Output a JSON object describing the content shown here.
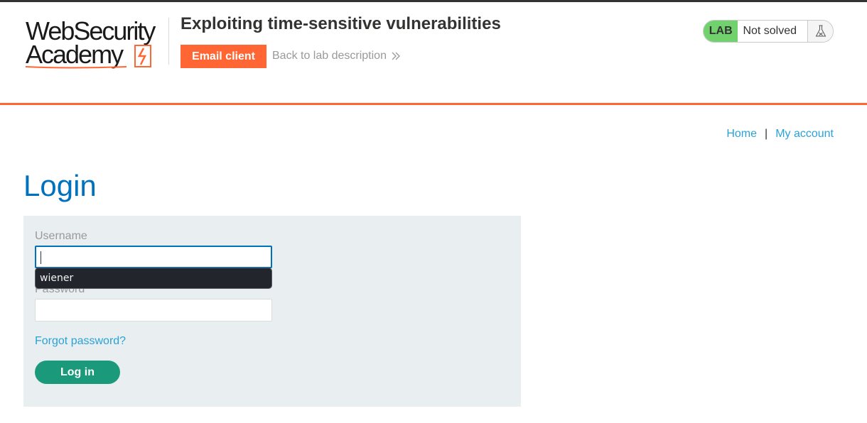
{
  "header": {
    "logo": {
      "line1": "WebSecurity",
      "line2": "Academy"
    },
    "lab_title": "Exploiting time-sensitive vulnerabilities",
    "email_client_label": "Email client",
    "back_link_label": "Back to lab description",
    "status": {
      "badge": "LAB",
      "text": "Not solved",
      "icon": "flask-icon"
    }
  },
  "nav": {
    "home": "Home",
    "separator": "|",
    "my_account": "My account"
  },
  "main": {
    "title": "Login",
    "form": {
      "username_label": "Username",
      "username_value": "",
      "autocomplete_suggestion": "wiener",
      "password_label": "Password",
      "password_value": "",
      "forgot_password": "Forgot password?",
      "submit_label": "Log in"
    }
  },
  "colors": {
    "accent_orange": "#ff6633",
    "link_blue": "#29a3d6",
    "title_blue": "#0071bc",
    "button_green": "#1a9a7b",
    "status_green": "#70d16d",
    "panel_bg": "#e9eef1"
  }
}
